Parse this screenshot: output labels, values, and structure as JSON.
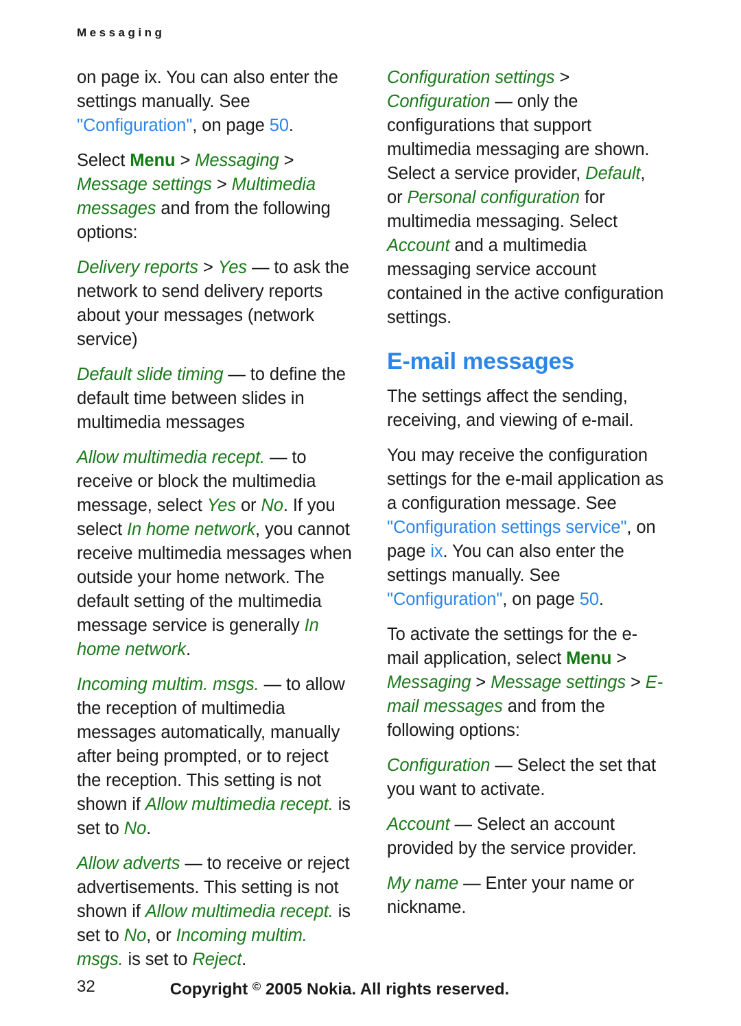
{
  "header": {
    "running_title": "Messaging"
  },
  "colors": {
    "ui_term_green": "#1a7a1a",
    "heading_blue": "#2c86e8",
    "xref_blue": "#2c86e8",
    "body_text": "#1a1a1a"
  },
  "left_column": {
    "paragraphs": [
      {
        "id": "p-config-ref",
        "runs": [
          {
            "text": "on page ix. You can also enter the settings manually. See ",
            "style": "normal"
          },
          {
            "text": "\"Configuration\"",
            "style": "xref"
          },
          {
            "text": ", on page ",
            "style": "normal"
          },
          {
            "text": "50",
            "style": "xref"
          },
          {
            "text": ".",
            "style": "normal"
          }
        ]
      },
      {
        "id": "p-select-menu-path",
        "runs": [
          {
            "text": "Select ",
            "style": "normal"
          },
          {
            "text": "Menu",
            "style": "ui-bold"
          },
          {
            "text": " > ",
            "style": "normal"
          },
          {
            "text": "Messaging",
            "style": "ui"
          },
          {
            "text": " > ",
            "style": "normal"
          },
          {
            "text": "Message settings",
            "style": "ui"
          },
          {
            "text": " > ",
            "style": "normal"
          },
          {
            "text": "Multimedia messages",
            "style": "ui"
          },
          {
            "text": " and from the following options:",
            "style": "normal"
          }
        ]
      },
      {
        "id": "p-delivery-reports",
        "runs": [
          {
            "text": "Delivery reports",
            "style": "ui"
          },
          {
            "text": " > ",
            "style": "normal"
          },
          {
            "text": "Yes",
            "style": "ui"
          },
          {
            "text": " — to ask the network to send delivery reports about your messages (network service)",
            "style": "normal"
          }
        ]
      },
      {
        "id": "p-default-slide-timing",
        "runs": [
          {
            "text": "Default slide timing",
            "style": "ui"
          },
          {
            "text": " — to define the default time between slides in multimedia messages",
            "style": "normal"
          }
        ]
      },
      {
        "id": "p-allow-multimedia-recept",
        "runs": [
          {
            "text": "Allow multimedia recept.",
            "style": "ui"
          },
          {
            "text": " — to receive or block the multimedia message, select ",
            "style": "normal"
          },
          {
            "text": "Yes",
            "style": "ui"
          },
          {
            "text": " or ",
            "style": "normal"
          },
          {
            "text": "No",
            "style": "ui"
          },
          {
            "text": ". If you select ",
            "style": "normal"
          },
          {
            "text": "In home network",
            "style": "ui"
          },
          {
            "text": ", you cannot receive multimedia messages when outside your home network. The default setting of the multimedia message service is generally ",
            "style": "normal"
          },
          {
            "text": "In home network",
            "style": "ui"
          },
          {
            "text": ".",
            "style": "normal"
          }
        ]
      },
      {
        "id": "p-incoming-multim-msgs",
        "runs": [
          {
            "text": "Incoming multim. msgs.",
            "style": "ui"
          },
          {
            "text": " — to allow the reception of multimedia messages automatically, manually after being prompted, or to reject the reception. This setting is not shown if ",
            "style": "normal"
          },
          {
            "text": "Allow multimedia recept.",
            "style": "ui"
          },
          {
            "text": " is set to ",
            "style": "normal"
          },
          {
            "text": "No",
            "style": "ui"
          },
          {
            "text": ".",
            "style": "normal"
          }
        ]
      },
      {
        "id": "p-allow-adverts",
        "runs": [
          {
            "text": "Allow adverts",
            "style": "ui"
          },
          {
            "text": " — to receive or reject advertisements. This setting is not shown if ",
            "style": "normal"
          },
          {
            "text": "Allow multimedia recept.",
            "style": "ui"
          },
          {
            "text": " is set to ",
            "style": "normal"
          },
          {
            "text": "No",
            "style": "ui"
          },
          {
            "text": ", or ",
            "style": "normal"
          },
          {
            "text": "Incoming multim. msgs.",
            "style": "ui"
          },
          {
            "text": " is set to ",
            "style": "normal"
          },
          {
            "text": "Reject",
            "style": "ui"
          },
          {
            "text": ".",
            "style": "normal"
          }
        ]
      }
    ]
  },
  "right_column": {
    "paragraphs_before_heading": [
      {
        "id": "p-configuration-settings",
        "runs": [
          {
            "text": "Configuration settings",
            "style": "ui"
          },
          {
            "text": " > ",
            "style": "normal"
          },
          {
            "text": "Configuration",
            "style": "ui"
          },
          {
            "text": " — only the configurations that support multimedia messaging are shown. Select a service provider, ",
            "style": "normal"
          },
          {
            "text": "Default",
            "style": "ui"
          },
          {
            "text": ", or ",
            "style": "normal"
          },
          {
            "text": "Personal configuration",
            "style": "ui"
          },
          {
            "text": " for multimedia messaging. Select ",
            "style": "normal"
          },
          {
            "text": "Account",
            "style": "ui"
          },
          {
            "text": " and a multimedia messaging service account contained in the active configuration settings.",
            "style": "normal"
          }
        ]
      }
    ],
    "heading": "E-mail messages",
    "paragraphs_after_heading": [
      {
        "id": "p-email-intro",
        "runs": [
          {
            "text": "The settings affect the sending, receiving, and viewing of e-mail.",
            "style": "normal"
          }
        ]
      },
      {
        "id": "p-email-config-message",
        "runs": [
          {
            "text": "You may receive the configuration settings for the e-mail application as a configuration message. See ",
            "style": "normal"
          },
          {
            "text": "\"Configuration settings service\"",
            "style": "xref"
          },
          {
            "text": ", on page ",
            "style": "normal"
          },
          {
            "text": "ix",
            "style": "xref"
          },
          {
            "text": ". You can also enter the settings manually. See ",
            "style": "normal"
          },
          {
            "text": "\"Configuration\"",
            "style": "xref"
          },
          {
            "text": ", on page ",
            "style": "normal"
          },
          {
            "text": "50",
            "style": "xref"
          },
          {
            "text": ".",
            "style": "normal"
          }
        ]
      },
      {
        "id": "p-email-activate-path",
        "runs": [
          {
            "text": "To activate the settings for the e-mail application, select ",
            "style": "normal"
          },
          {
            "text": "Menu",
            "style": "ui-bold"
          },
          {
            "text": " > ",
            "style": "normal"
          },
          {
            "text": "Messaging",
            "style": "ui"
          },
          {
            "text": " > ",
            "style": "normal"
          },
          {
            "text": "Message settings",
            "style": "ui"
          },
          {
            "text": " > ",
            "style": "normal"
          },
          {
            "text": "E-mail messages",
            "style": "ui"
          },
          {
            "text": " and from the following options:",
            "style": "normal"
          }
        ]
      },
      {
        "id": "p-email-configuration",
        "runs": [
          {
            "text": "Configuration",
            "style": "ui"
          },
          {
            "text": " — Select the set that you want to activate.",
            "style": "normal"
          }
        ]
      },
      {
        "id": "p-email-account",
        "runs": [
          {
            "text": "Account",
            "style": "ui"
          },
          {
            "text": " — Select an account provided by the service provider.",
            "style": "normal"
          }
        ]
      },
      {
        "id": "p-email-my-name",
        "runs": [
          {
            "text": "My name",
            "style": "ui"
          },
          {
            "text": " — Enter your name or nickname.",
            "style": "normal"
          }
        ]
      }
    ]
  },
  "footer": {
    "page_number": "32",
    "copyright_prefix": "Copyright ",
    "copyright_symbol": "©",
    "copyright_suffix": " 2005 Nokia. All rights reserved."
  }
}
